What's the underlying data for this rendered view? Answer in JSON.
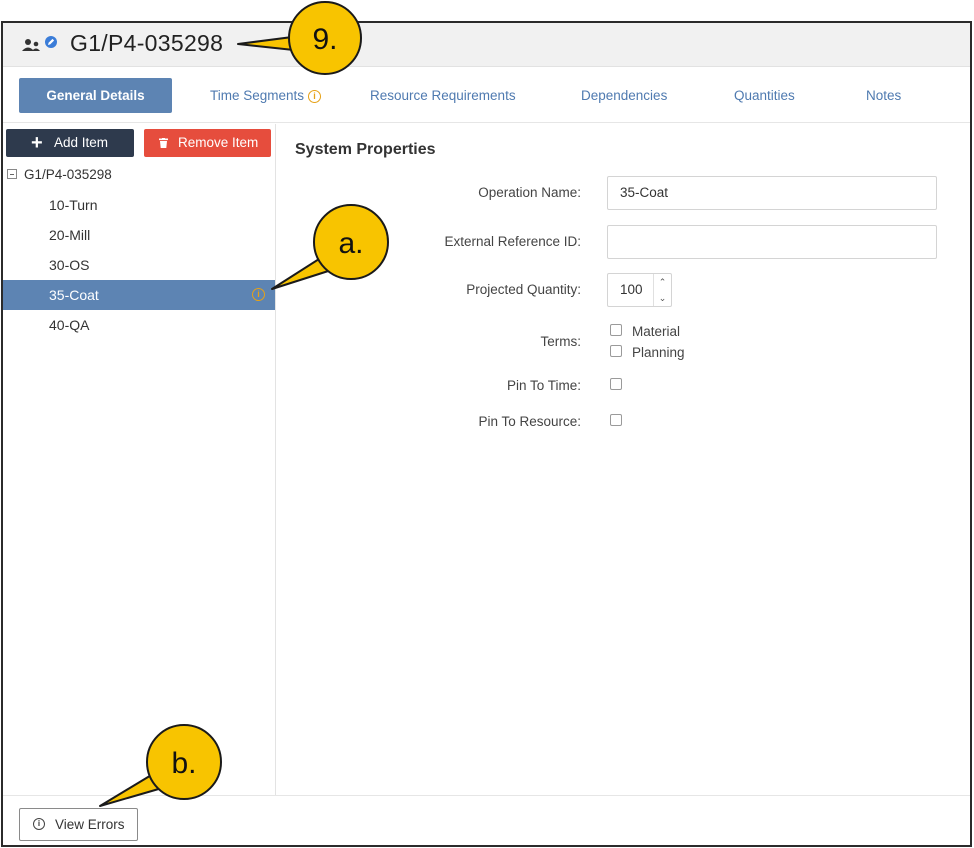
{
  "window": {
    "title": "G1/P4-035298"
  },
  "tabs": [
    {
      "label": "General Details"
    },
    {
      "label": "Time Segments"
    },
    {
      "label": "Resource Requirements"
    },
    {
      "label": "Dependencies"
    },
    {
      "label": "Quantities"
    },
    {
      "label": "Notes"
    }
  ],
  "toolbar": {
    "add_label": "Add Item",
    "remove_label": "Remove Item"
  },
  "tree": {
    "root": "G1/P4-035298",
    "items": [
      {
        "label": "10-Turn"
      },
      {
        "label": "20-Mill"
      },
      {
        "label": "30-OS"
      },
      {
        "label": "35-Coat"
      },
      {
        "label": "40-QA"
      }
    ],
    "selected": "35-Coat"
  },
  "properties": {
    "section_title": "System Properties",
    "operation_name_label": "Operation Name:",
    "operation_name_value": "35-Coat",
    "external_ref_label": "External Reference ID:",
    "external_ref_value": "",
    "projected_qty_label": "Projected Quantity:",
    "projected_qty_value": "100",
    "terms_label": "Terms:",
    "terms_options": [
      "Material",
      "Planning"
    ],
    "pin_time_label": "Pin To Time:",
    "pin_resource_label": "Pin To Resource:"
  },
  "footer": {
    "view_errors_label": "View Errors"
  },
  "callouts": {
    "title": "9.",
    "tree": "a.",
    "errors": "b."
  },
  "colors": {
    "accent": "#5d84b3",
    "danger": "#e64d3d",
    "dark": "#2e3a4d",
    "warning": "#e6a117",
    "callout": "#f8c400"
  },
  "icons": [
    "users-edit-icon",
    "info-icon",
    "plus-icon",
    "trash-icon",
    "collapse-icon",
    "chevron-up-icon",
    "chevron-down-icon"
  ]
}
